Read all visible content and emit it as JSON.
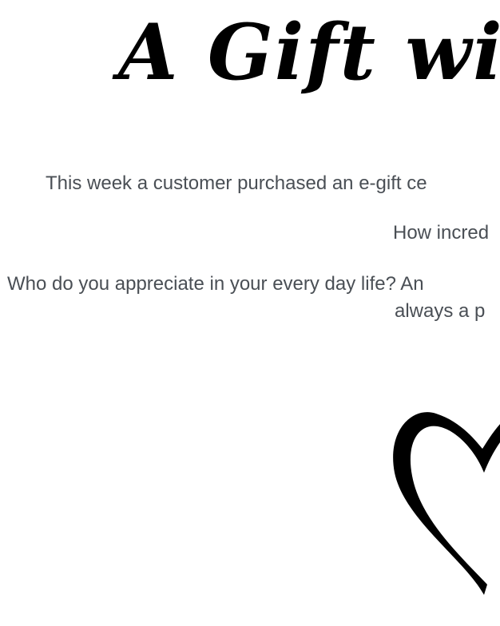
{
  "headline": "A Gift wi",
  "paragraphs": {
    "line1": "This week a customer purchased an e-gift ce",
    "line2": "How incred",
    "line3": "Who do you appreciate in your every day life? An",
    "line4": "always a p"
  },
  "icons": {
    "heart": "heart-outline-icon"
  },
  "colors": {
    "background": "#ffffff",
    "headline": "#000000",
    "body_text": "#4a4f55",
    "heart": "#000000"
  }
}
